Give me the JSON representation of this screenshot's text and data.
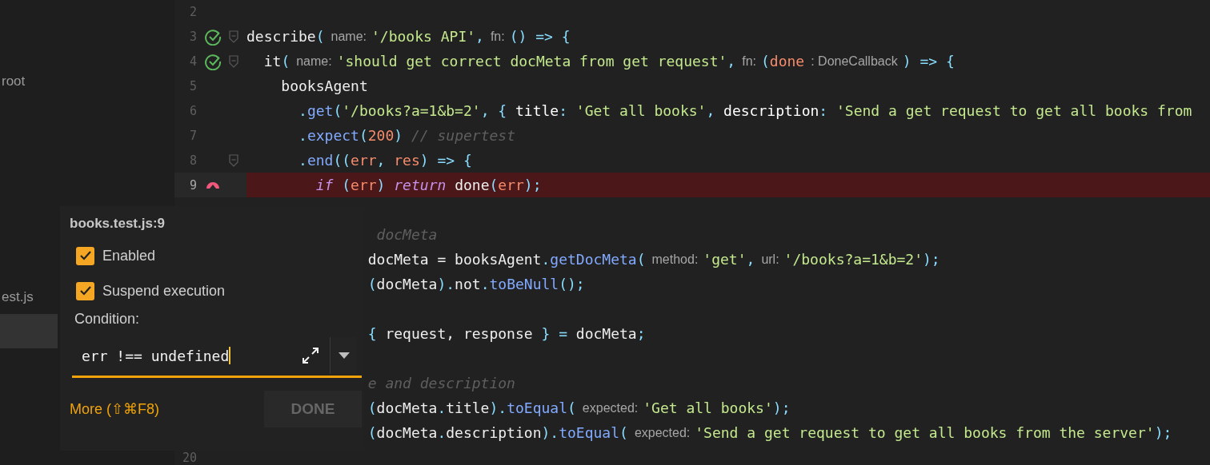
{
  "sidebar": {
    "items": [
      {
        "label": "root",
        "selected": false
      },
      {
        "label": "est.js",
        "selected": false
      },
      {
        "selected": true
      }
    ]
  },
  "editor": {
    "lines": [
      {
        "number": "2",
        "passed": false,
        "breakpoint": false,
        "fold": false,
        "highlighted": false
      },
      {
        "number": "3",
        "passed": true,
        "breakpoint": false,
        "fold": true,
        "highlighted": false,
        "tokens": [
          {
            "text": "describe",
            "kind": "plain"
          },
          {
            "text": "(",
            "kind": "punct"
          },
          {
            "text": "name:",
            "kind": "hint"
          },
          {
            "text": "'/books API'",
            "kind": "str"
          },
          {
            "text": ",",
            "kind": "punct"
          },
          {
            "text": "fn:",
            "kind": "hint"
          },
          {
            "text": "() => {",
            "kind": "punct"
          }
        ]
      },
      {
        "number": "4",
        "passed": true,
        "breakpoint": false,
        "fold": true,
        "highlighted": false,
        "tokens": [
          {
            "text": "  it",
            "kind": "plain"
          },
          {
            "text": "(",
            "kind": "punct"
          },
          {
            "text": "name:",
            "kind": "hint"
          },
          {
            "text": "'should get correct docMeta from get request'",
            "kind": "str"
          },
          {
            "text": ",",
            "kind": "punct"
          },
          {
            "text": "fn:",
            "kind": "hint"
          },
          {
            "text": "(",
            "kind": "punct"
          },
          {
            "text": "done",
            "kind": "param"
          },
          {
            "text": ": DoneCallback",
            "kind": "hint"
          },
          {
            "text": ") => {",
            "kind": "punct"
          }
        ]
      },
      {
        "number": "5",
        "passed": false,
        "breakpoint": false,
        "fold": false,
        "highlighted": false,
        "tokens": [
          {
            "text": "    booksAgent",
            "kind": "plain"
          }
        ]
      },
      {
        "number": "6",
        "passed": false,
        "breakpoint": false,
        "fold": false,
        "highlighted": false,
        "tokens": [
          {
            "text": "      .",
            "kind": "punct"
          },
          {
            "text": "get",
            "kind": "fn"
          },
          {
            "text": "(",
            "kind": "punct"
          },
          {
            "text": "'/books?a=1&b=2'",
            "kind": "str"
          },
          {
            "text": ", { ",
            "kind": "punct"
          },
          {
            "text": "title",
            "kind": "prop"
          },
          {
            "text": ": ",
            "kind": "punct"
          },
          {
            "text": "'Get all books'",
            "kind": "str"
          },
          {
            "text": ", ",
            "kind": "punct"
          },
          {
            "text": "description",
            "kind": "prop"
          },
          {
            "text": ": ",
            "kind": "punct"
          },
          {
            "text": "'Send a get request to get all books from",
            "kind": "str"
          }
        ]
      },
      {
        "number": "7",
        "passed": false,
        "breakpoint": false,
        "fold": false,
        "highlighted": false,
        "tokens": [
          {
            "text": "      .",
            "kind": "punct"
          },
          {
            "text": "expect",
            "kind": "fn"
          },
          {
            "text": "(",
            "kind": "punct"
          },
          {
            "text": "200",
            "kind": "num"
          },
          {
            "text": ")",
            "kind": "punct"
          },
          {
            "text": " // supertest",
            "kind": "comment"
          }
        ]
      },
      {
        "number": "8",
        "passed": false,
        "breakpoint": false,
        "fold": true,
        "highlighted": false,
        "tokens": [
          {
            "text": "      .",
            "kind": "punct"
          },
          {
            "text": "end",
            "kind": "fn"
          },
          {
            "text": "((",
            "kind": "punct"
          },
          {
            "text": "err",
            "kind": "param"
          },
          {
            "text": ", ",
            "kind": "punct"
          },
          {
            "text": "res",
            "kind": "param"
          },
          {
            "text": ") => {",
            "kind": "punct"
          }
        ]
      },
      {
        "number": "9",
        "passed": false,
        "breakpoint": true,
        "fold": false,
        "highlighted": true,
        "tokens": [
          {
            "text": "        if",
            "kind": "kw"
          },
          {
            "text": " (",
            "kind": "punct"
          },
          {
            "text": "err",
            "kind": "param"
          },
          {
            "text": ") ",
            "kind": "punct"
          },
          {
            "text": "return",
            "kind": "kw"
          },
          {
            "text": " done",
            "kind": "plain"
          },
          {
            "text": "(",
            "kind": "punct"
          },
          {
            "text": "err",
            "kind": "param"
          },
          {
            "text": ");",
            "kind": "punct"
          }
        ]
      },
      {
        "passed": false,
        "breakpoint": false,
        "fold": false,
        "highlighted": false
      },
      {
        "passed": false,
        "breakpoint": false,
        "fold": false,
        "highlighted": false,
        "tokens": [
          {
            "text": "               docMeta",
            "kind": "comment"
          }
        ]
      },
      {
        "passed": false,
        "breakpoint": false,
        "fold": false,
        "highlighted": false,
        "tokens": [
          {
            "text": "              docMeta = booksAgent",
            "kind": "plain"
          },
          {
            "text": ".",
            "kind": "punct"
          },
          {
            "text": "getDocMeta",
            "kind": "fn"
          },
          {
            "text": "(",
            "kind": "punct"
          },
          {
            "text": "method:",
            "kind": "hint"
          },
          {
            "text": "'get'",
            "kind": "str"
          },
          {
            "text": ",",
            "kind": "punct"
          },
          {
            "text": "url:",
            "kind": "hint"
          },
          {
            "text": "'/books?a=1&b=2'",
            "kind": "str"
          },
          {
            "text": ");",
            "kind": "punct"
          }
        ]
      },
      {
        "passed": false,
        "breakpoint": false,
        "fold": false,
        "highlighted": false,
        "tokens": [
          {
            "text": "              (",
            "kind": "punct"
          },
          {
            "text": "docMeta",
            "kind": "plain"
          },
          {
            "text": ").",
            "kind": "punct"
          },
          {
            "text": "not",
            "kind": "plain"
          },
          {
            "text": ".",
            "kind": "punct"
          },
          {
            "text": "toBeNull",
            "kind": "fn"
          },
          {
            "text": "();",
            "kind": "punct"
          }
        ]
      },
      {
        "passed": false,
        "breakpoint": false,
        "fold": false,
        "highlighted": false
      },
      {
        "passed": false,
        "breakpoint": false,
        "fold": false,
        "highlighted": false,
        "tokens": [
          {
            "text": "              {",
            "kind": "punct"
          },
          {
            "text": " request, response ",
            "kind": "plain"
          },
          {
            "text": "} =",
            "kind": "punct"
          },
          {
            "text": " docMeta",
            "kind": "plain"
          },
          {
            "text": ";",
            "kind": "punct"
          }
        ]
      },
      {
        "passed": false,
        "breakpoint": false,
        "fold": false,
        "highlighted": false
      },
      {
        "passed": false,
        "breakpoint": false,
        "fold": false,
        "highlighted": false,
        "tokens": [
          {
            "text": "              e and description",
            "kind": "comment"
          }
        ]
      },
      {
        "passed": false,
        "breakpoint": false,
        "fold": false,
        "highlighted": false,
        "tokens": [
          {
            "text": "              (",
            "kind": "punct"
          },
          {
            "text": "docMeta",
            "kind": "plain"
          },
          {
            "text": ".",
            "kind": "punct"
          },
          {
            "text": "title",
            "kind": "plain"
          },
          {
            "text": ").",
            "kind": "punct"
          },
          {
            "text": "toEqual",
            "kind": "fn"
          },
          {
            "text": "(",
            "kind": "punct"
          },
          {
            "text": "expected:",
            "kind": "hint"
          },
          {
            "text": "'Get all books'",
            "kind": "str"
          },
          {
            "text": ");",
            "kind": "punct"
          }
        ]
      },
      {
        "passed": false,
        "breakpoint": false,
        "fold": false,
        "highlighted": false,
        "tokens": [
          {
            "text": "              (",
            "kind": "punct"
          },
          {
            "text": "docMeta",
            "kind": "plain"
          },
          {
            "text": ".",
            "kind": "punct"
          },
          {
            "text": "description",
            "kind": "plain"
          },
          {
            "text": ").",
            "kind": "punct"
          },
          {
            "text": "toEqual",
            "kind": "fn"
          },
          {
            "text": "(",
            "kind": "punct"
          },
          {
            "text": "expected:",
            "kind": "hint"
          },
          {
            "text": "'Send a get request to get all books from the server'",
            "kind": "str"
          },
          {
            "text": ");",
            "kind": "punct"
          }
        ]
      },
      {
        "number": "20",
        "passed": false,
        "breakpoint": false,
        "fold": false,
        "highlighted": false
      }
    ]
  },
  "breakpoint_popup": {
    "title": "books.test.js:9",
    "options": [
      {
        "label": "Enabled",
        "checked": true
      },
      {
        "label": "Suspend execution",
        "checked": true
      }
    ],
    "condition_label": "Condition:",
    "condition": {
      "value": "err !== undefined",
      "focused": true
    },
    "more_link": "More (⇧⌘F8)",
    "done_button": {
      "label": "DONE",
      "disabled": true
    }
  }
}
